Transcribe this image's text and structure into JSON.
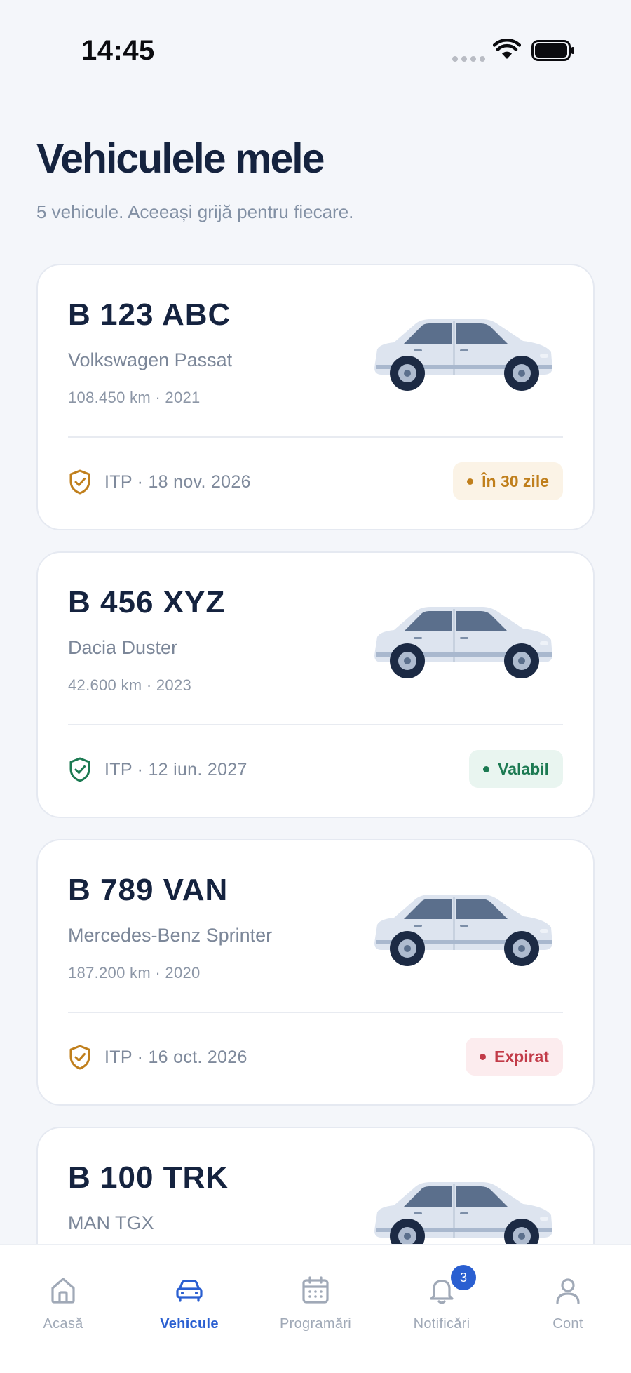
{
  "status_bar": {
    "time": "14:45"
  },
  "header": {
    "title": "Vehiculele mele",
    "subtitle": "5 vehicule. Aceeași grijă pentru fiecare."
  },
  "colors": {
    "accent": "#2a5fd1",
    "warning": "#c07f1c",
    "valid": "#1c7a52",
    "expired": "#c23b48"
  },
  "vehicles": [
    {
      "plate": "B 123 ABC",
      "model": "Volkswagen Passat",
      "meta": "108.450 km · 2021",
      "itp": "ITP · 18 nov. 2026",
      "status": "În 30 zile",
      "status_type": "warn",
      "icon": "shield-check-icon"
    },
    {
      "plate": "B 456 XYZ",
      "model": "Dacia Duster",
      "meta": "42.600 km · 2023",
      "itp": "ITP · 12 iun. 2027",
      "status": "Valabil",
      "status_type": "ok",
      "icon": "shield-check-icon"
    },
    {
      "plate": "B 789 VAN",
      "model": "Mercedes-Benz Sprinter",
      "meta": "187.200 km · 2020",
      "itp": "ITP · 16 oct. 2026",
      "status": "Expirat",
      "status_type": "bad",
      "icon": "shield-check-icon"
    },
    {
      "plate": "B 100 TRK",
      "model": "MAN TGX",
      "meta": "",
      "itp": "",
      "status": "",
      "status_type": "",
      "icon": "shield-check-icon"
    }
  ],
  "tab_bar": {
    "tabs": [
      {
        "label": "Acasă",
        "icon": "home-icon",
        "active": false
      },
      {
        "label": "Vehicule",
        "icon": "car-icon",
        "active": true
      },
      {
        "label": "Programări",
        "icon": "calendar-icon",
        "active": false
      },
      {
        "label": "Notificări",
        "icon": "bell-icon",
        "active": false,
        "badge": "3"
      },
      {
        "label": "Cont",
        "icon": "user-icon",
        "active": false
      }
    ]
  }
}
